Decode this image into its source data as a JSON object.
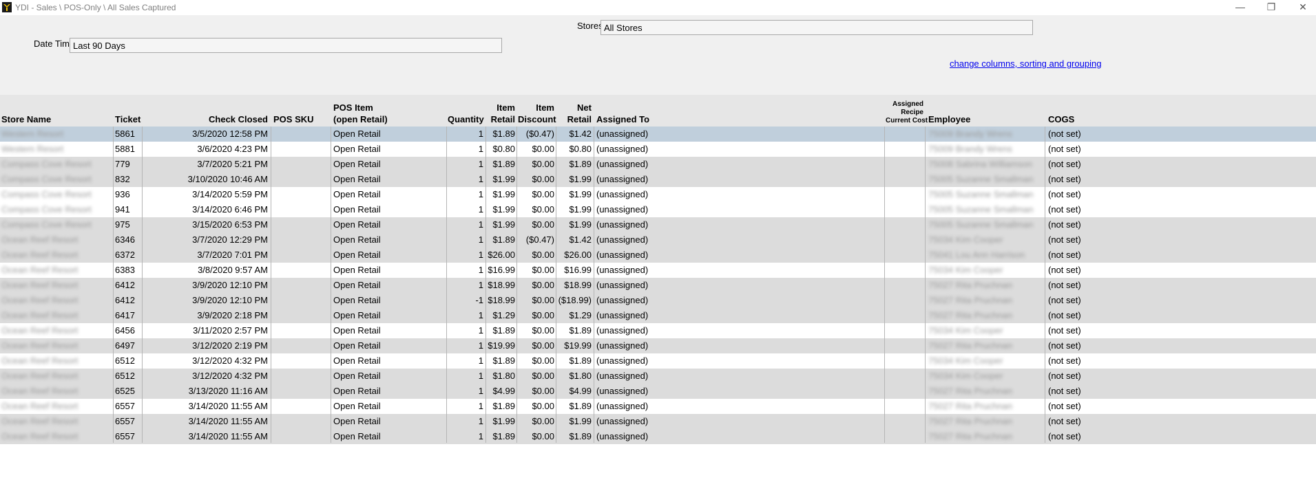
{
  "window": {
    "title": "YDI - Sales \\ POS-Only \\ All Sales Captured",
    "minimize_glyph": "—",
    "maximize_glyph": "❐",
    "close_glyph": "✕"
  },
  "filters": {
    "stores_label": "Stores",
    "stores_value": "All Stores",
    "datetime_label": "Date Time",
    "datetime_value": "Last 90 Days",
    "columns_link": "change columns, sorting and grouping"
  },
  "columns": {
    "store_name": "Store Name",
    "ticket": "Ticket",
    "check_closed": "Check Closed",
    "pos_sku": "POS SKU",
    "pos_item_line1": "POS Item",
    "pos_item_line2": "(open Retail)",
    "quantity": "Quantity",
    "item_retail_line1": "Item",
    "item_retail_line2": "Retail",
    "item_discount_line1": "Item",
    "item_discount_line2": "Discount",
    "net_retail_line1": "Net",
    "net_retail_line2": "Retail",
    "assigned_to": "Assigned To",
    "assigned_recipe_line1": "Assigned",
    "assigned_recipe_line2": "Recipe",
    "assigned_recipe_line3": "Current Cost",
    "employee": "Employee",
    "cogs": "COGS"
  },
  "rows": [
    {
      "store": "Western Resort",
      "ticket": "5861",
      "closed": "3/5/2020 12:58 PM",
      "sku": "",
      "item": "Open Retail",
      "qty": "1",
      "retail": "$1.89",
      "discount": "($0.47)",
      "net": "$1.42",
      "assigned": "(unassigned)",
      "employee": "75009 Brandy Wrens",
      "cogs": "(not set)"
    },
    {
      "store": "Western Resort",
      "ticket": "5881",
      "closed": "3/6/2020 4:23 PM",
      "sku": "",
      "item": "Open Retail",
      "qty": "1",
      "retail": "$0.80",
      "discount": "$0.00",
      "net": "$0.80",
      "assigned": "(unassigned)",
      "employee": "75009 Brandy Wrens",
      "cogs": "(not set)"
    },
    {
      "store": "Compass Cove Resort",
      "ticket": "779",
      "closed": "3/7/2020 5:21 PM",
      "sku": "",
      "item": "Open Retail",
      "qty": "1",
      "retail": "$1.89",
      "discount": "$0.00",
      "net": "$1.89",
      "assigned": "(unassigned)",
      "employee": "75008 Sabrina Williamson",
      "cogs": "(not set)"
    },
    {
      "store": "Compass Cove Resort",
      "ticket": "832",
      "closed": "3/10/2020 10:46 AM",
      "sku": "",
      "item": "Open Retail",
      "qty": "1",
      "retail": "$1.99",
      "discount": "$0.00",
      "net": "$1.99",
      "assigned": "(unassigned)",
      "employee": "75005 Suzanne Smallman",
      "cogs": "(not set)"
    },
    {
      "store": "Compass Cove Resort",
      "ticket": "936",
      "closed": "3/14/2020 5:59 PM",
      "sku": "",
      "item": "Open Retail",
      "qty": "1",
      "retail": "$1.99",
      "discount": "$0.00",
      "net": "$1.99",
      "assigned": "(unassigned)",
      "employee": "75005 Suzanne Smallman",
      "cogs": "(not set)"
    },
    {
      "store": "Compass Cove Resort",
      "ticket": "941",
      "closed": "3/14/2020 6:46 PM",
      "sku": "",
      "item": "Open Retail",
      "qty": "1",
      "retail": "$1.99",
      "discount": "$0.00",
      "net": "$1.99",
      "assigned": "(unassigned)",
      "employee": "75005 Suzanne Smallman",
      "cogs": "(not set)"
    },
    {
      "store": "Compass Cove Resort",
      "ticket": "975",
      "closed": "3/15/2020 6:53 PM",
      "sku": "",
      "item": "Open Retail",
      "qty": "1",
      "retail": "$1.99",
      "discount": "$0.00",
      "net": "$1.99",
      "assigned": "(unassigned)",
      "employee": "75005 Suzanne Smallman",
      "cogs": "(not set)"
    },
    {
      "store": "Ocean Reef Resort",
      "ticket": "6346",
      "closed": "3/7/2020 12:29 PM",
      "sku": "",
      "item": "Open Retail",
      "qty": "1",
      "retail": "$1.89",
      "discount": "($0.47)",
      "net": "$1.42",
      "assigned": "(unassigned)",
      "employee": "75034 Kim Cooper",
      "cogs": "(not set)"
    },
    {
      "store": "Ocean Reef Resort",
      "ticket": "6372",
      "closed": "3/7/2020 7:01 PM",
      "sku": "",
      "item": "Open Retail",
      "qty": "1",
      "retail": "$26.00",
      "discount": "$0.00",
      "net": "$26.00",
      "assigned": "(unassigned)",
      "employee": "75041 Lou Ann Harrison",
      "cogs": "(not set)"
    },
    {
      "store": "Ocean Reef Resort",
      "ticket": "6383",
      "closed": "3/8/2020 9:57 AM",
      "sku": "",
      "item": "Open Retail",
      "qty": "1",
      "retail": "$16.99",
      "discount": "$0.00",
      "net": "$16.99",
      "assigned": "(unassigned)",
      "employee": "75034 Kim Cooper",
      "cogs": "(not set)"
    },
    {
      "store": "Ocean Reef Resort",
      "ticket": "6412",
      "closed": "3/9/2020 12:10 PM",
      "sku": "",
      "item": "Open Retail",
      "qty": "1",
      "retail": "$18.99",
      "discount": "$0.00",
      "net": "$18.99",
      "assigned": "(unassigned)",
      "employee": "75027 Rita Pruchnan",
      "cogs": "(not set)"
    },
    {
      "store": "Ocean Reef Resort",
      "ticket": "6412",
      "closed": "3/9/2020 12:10 PM",
      "sku": "",
      "item": "Open Retail",
      "qty": "-1",
      "retail": "$18.99",
      "discount": "$0.00",
      "net": "($18.99)",
      "assigned": "(unassigned)",
      "employee": "75027 Rita Pruchnan",
      "cogs": "(not set)"
    },
    {
      "store": "Ocean Reef Resort",
      "ticket": "6417",
      "closed": "3/9/2020 2:18 PM",
      "sku": "",
      "item": "Open Retail",
      "qty": "1",
      "retail": "$1.29",
      "discount": "$0.00",
      "net": "$1.29",
      "assigned": "(unassigned)",
      "employee": "75027 Rita Pruchnan",
      "cogs": "(not set)"
    },
    {
      "store": "Ocean Reef Resort",
      "ticket": "6456",
      "closed": "3/11/2020 2:57 PM",
      "sku": "",
      "item": "Open Retail",
      "qty": "1",
      "retail": "$1.89",
      "discount": "$0.00",
      "net": "$1.89",
      "assigned": "(unassigned)",
      "employee": "75034 Kim Cooper",
      "cogs": "(not set)"
    },
    {
      "store": "Ocean Reef Resort",
      "ticket": "6497",
      "closed": "3/12/2020 2:19 PM",
      "sku": "",
      "item": "Open Retail",
      "qty": "1",
      "retail": "$19.99",
      "discount": "$0.00",
      "net": "$19.99",
      "assigned": "(unassigned)",
      "employee": "75027 Rita Pruchnan",
      "cogs": "(not set)"
    },
    {
      "store": "Ocean Reef Resort",
      "ticket": "6512",
      "closed": "3/12/2020 4:32 PM",
      "sku": "",
      "item": "Open Retail",
      "qty": "1",
      "retail": "$1.89",
      "discount": "$0.00",
      "net": "$1.89",
      "assigned": "(unassigned)",
      "employee": "75034 Kim Cooper",
      "cogs": "(not set)"
    },
    {
      "store": "Ocean Reef Resort",
      "ticket": "6512",
      "closed": "3/12/2020 4:32 PM",
      "sku": "",
      "item": "Open Retail",
      "qty": "1",
      "retail": "$1.80",
      "discount": "$0.00",
      "net": "$1.80",
      "assigned": "(unassigned)",
      "employee": "75034 Kim Cooper",
      "cogs": "(not set)"
    },
    {
      "store": "Ocean Reef Resort",
      "ticket": "6525",
      "closed": "3/13/2020 11:16 AM",
      "sku": "",
      "item": "Open Retail",
      "qty": "1",
      "retail": "$4.99",
      "discount": "$0.00",
      "net": "$4.99",
      "assigned": "(unassigned)",
      "employee": "75027 Rita Pruchnan",
      "cogs": "(not set)"
    },
    {
      "store": "Ocean Reef Resort",
      "ticket": "6557",
      "closed": "3/14/2020 11:55 AM",
      "sku": "",
      "item": "Open Retail",
      "qty": "1",
      "retail": "$1.89",
      "discount": "$0.00",
      "net": "$1.89",
      "assigned": "(unassigned)",
      "employee": "75027 Rita Pruchnan",
      "cogs": "(not set)"
    },
    {
      "store": "Ocean Reef Resort",
      "ticket": "6557",
      "closed": "3/14/2020 11:55 AM",
      "sku": "",
      "item": "Open Retail",
      "qty": "1",
      "retail": "$1.99",
      "discount": "$0.00",
      "net": "$1.99",
      "assigned": "(unassigned)",
      "employee": "75027 Rita Pruchnan",
      "cogs": "(not set)"
    },
    {
      "store": "Ocean Reef Resort",
      "ticket": "6557",
      "closed": "3/14/2020 11:55 AM",
      "sku": "",
      "item": "Open Retail",
      "qty": "1",
      "retail": "$1.89",
      "discount": "$0.00",
      "net": "$1.89",
      "assigned": "(unassigned)",
      "employee": "75027 Rita Pruchnan",
      "cogs": "(not set)"
    }
  ]
}
